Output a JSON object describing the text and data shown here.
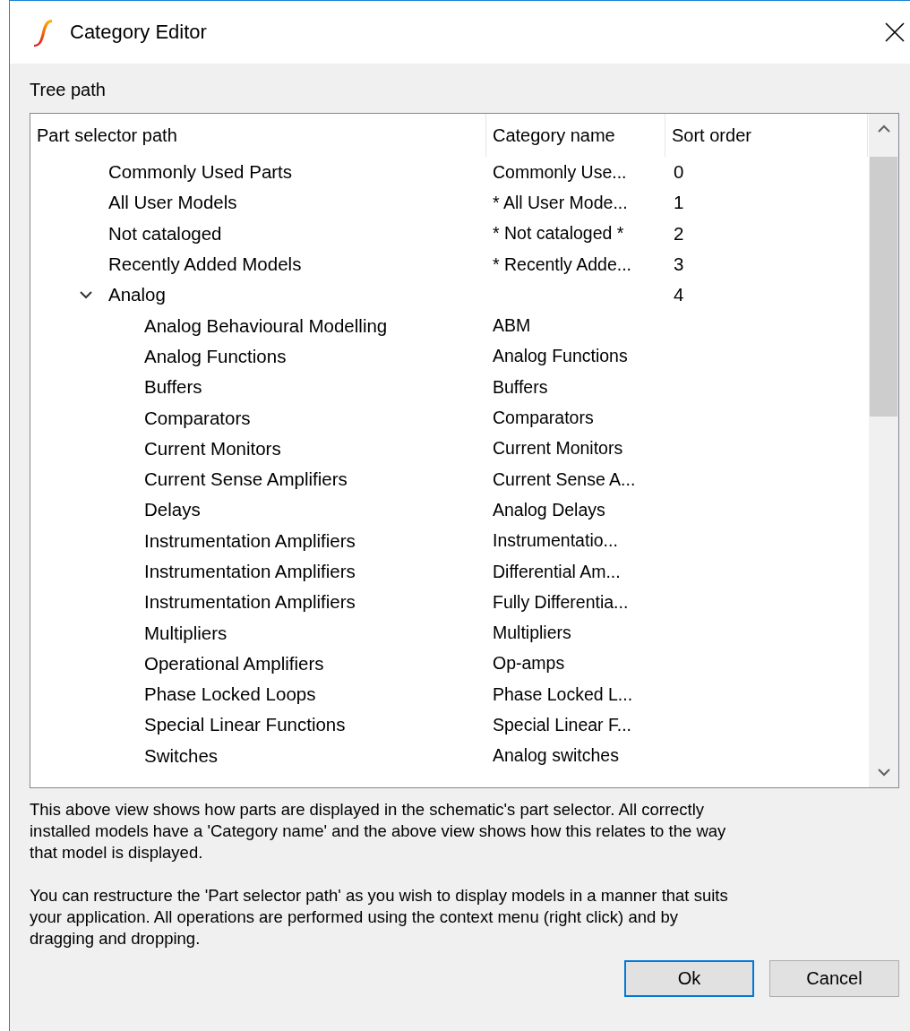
{
  "window": {
    "title": "Category Editor"
  },
  "section_label": "Tree path",
  "tree": {
    "columns": [
      "Part selector path",
      "Category name",
      "Sort order"
    ],
    "items": [
      {
        "path": "Commonly Used Parts",
        "category": "Commonly Use...",
        "sort": "0"
      },
      {
        "path": "All User Models",
        "category": "* All User Mode...",
        "sort": "1"
      },
      {
        "path": "Not cataloged",
        "category": "* Not cataloged *",
        "sort": "2"
      },
      {
        "path": "Recently Added Models",
        "category": "* Recently Adde...",
        "sort": "3"
      },
      {
        "path": "Analog",
        "sort": "4",
        "expanded": true,
        "children": [
          {
            "path": "Analog Behavioural Modelling",
            "category": "ABM"
          },
          {
            "path": "Analog Functions",
            "category": "Analog Functions"
          },
          {
            "path": "Buffers",
            "category": "Buffers"
          },
          {
            "path": "Comparators",
            "category": "Comparators"
          },
          {
            "path": "Current Monitors",
            "category": "Current Monitors"
          },
          {
            "path": "Current Sense Amplifiers",
            "category": "Current Sense A..."
          },
          {
            "path": "Delays",
            "category": "Analog Delays"
          },
          {
            "path": "Instrumentation Amplifiers",
            "category": "Instrumentatio..."
          },
          {
            "path": "Instrumentation Amplifiers",
            "category": "Differential Am..."
          },
          {
            "path": "Instrumentation Amplifiers",
            "category": "Fully Differentia..."
          },
          {
            "path": "Multipliers",
            "category": "Multipliers"
          },
          {
            "path": "Operational Amplifiers",
            "category": "Op-amps"
          },
          {
            "path": "Phase Locked Loops",
            "category": "Phase Locked L..."
          },
          {
            "path": "Special Linear Functions",
            "category": "Special Linear F..."
          },
          {
            "path": "Switches",
            "category": "Analog switches"
          }
        ]
      }
    ]
  },
  "description": [
    "This above view shows how parts are displayed in the schematic's part selector. All correctly installed models have a 'Category name' and the above view shows how this relates to the way that model is displayed.",
    "You can restructure the 'Part selector path' as you wish to display models in a manner that suits your application. All operations are performed using the context menu (right click) and by dragging and dropping."
  ],
  "buttons": [
    {
      "label": "Ok",
      "default": true
    },
    {
      "label": "Cancel",
      "default": false
    }
  ]
}
